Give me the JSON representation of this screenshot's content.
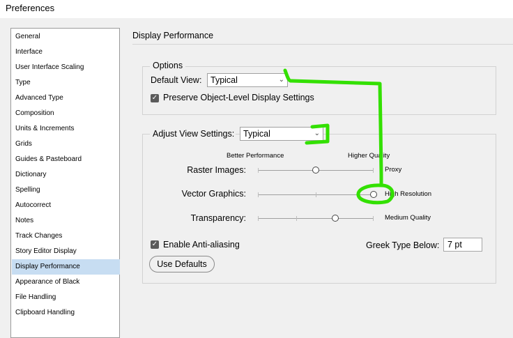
{
  "window": {
    "title": "Preferences"
  },
  "sidebar": {
    "items": [
      {
        "label": "General"
      },
      {
        "label": "Interface"
      },
      {
        "label": "User Interface Scaling"
      },
      {
        "label": "Type"
      },
      {
        "label": "Advanced Type"
      },
      {
        "label": "Composition"
      },
      {
        "label": "Units & Increments"
      },
      {
        "label": "Grids"
      },
      {
        "label": "Guides & Pasteboard"
      },
      {
        "label": "Dictionary"
      },
      {
        "label": "Spelling"
      },
      {
        "label": "Autocorrect"
      },
      {
        "label": "Notes"
      },
      {
        "label": "Track Changes"
      },
      {
        "label": "Story Editor Display"
      },
      {
        "label": "Display Performance"
      },
      {
        "label": "Appearance of Black"
      },
      {
        "label": "File Handling"
      },
      {
        "label": "Clipboard Handling"
      }
    ],
    "selected": "Display Performance"
  },
  "panel": {
    "heading": "Display Performance"
  },
  "options": {
    "legend": "Options",
    "default_view_label": "Default View:",
    "default_view_value": "Typical",
    "preserve_label": "Preserve Object-Level Display Settings",
    "preserve_checked": true
  },
  "adjust": {
    "label": "Adjust View Settings:",
    "value": "Typical",
    "better_performance": "Better Performance",
    "higher_quality": "Higher Quality",
    "sliders": [
      {
        "label": "Raster Images:",
        "value_text": "Proxy",
        "level": 0.5
      },
      {
        "label": "Vector Graphics:",
        "value_text": "High Resolution",
        "level": 1.0
      },
      {
        "label": "Transparency:",
        "value_text": "Medium Quality",
        "level": 0.67
      }
    ],
    "anti_alias_label": "Enable Anti-aliasing",
    "anti_alias_checked": true,
    "greek_label": "Greek Type Below:",
    "greek_value": "7 pt",
    "use_defaults": "Use Defaults"
  },
  "colors": {
    "selection": "#c7ddf2",
    "annotation": "#33e000"
  }
}
